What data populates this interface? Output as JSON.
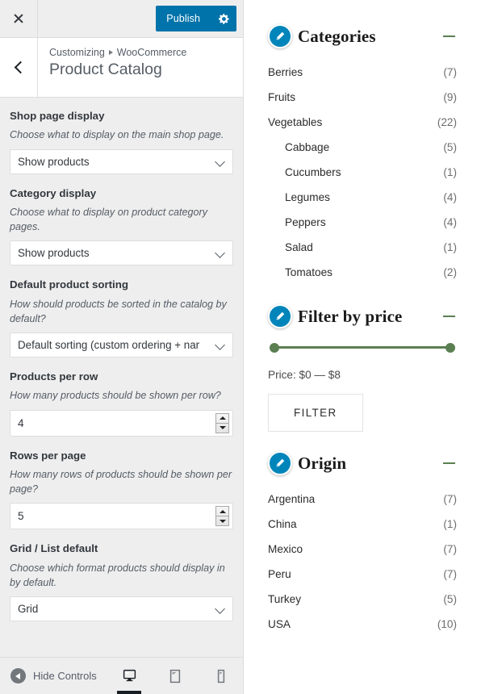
{
  "customizer": {
    "close_label": "Close",
    "publish_label": "Publish",
    "gear_icon": "gear-icon",
    "back_label": "Back",
    "breadcrumb": {
      "root": "Customizing",
      "section": "WooCommerce"
    },
    "title": "Product Catalog",
    "controls": [
      {
        "id": "shop-page-display",
        "label": "Shop page display",
        "description": "Choose what to display on the main shop page.",
        "type": "select",
        "value": "Show products"
      },
      {
        "id": "category-display",
        "label": "Category display",
        "description": "Choose what to display on product category pages.",
        "type": "select",
        "value": "Show products"
      },
      {
        "id": "default-product-sorting",
        "label": "Default product sorting",
        "description": "How should products be sorted in the catalog by default?",
        "type": "select",
        "value": "Default sorting (custom ordering + nar"
      },
      {
        "id": "products-per-row",
        "label": "Products per row",
        "description": "How many products should be shown per row?",
        "type": "number",
        "value": "4"
      },
      {
        "id": "rows-per-page",
        "label": "Rows per page",
        "description": "How many rows of products should be shown per page?",
        "type": "number",
        "value": "5"
      },
      {
        "id": "grid-list-default",
        "label": "Grid / List default",
        "description": "Choose which format products should display in by default.",
        "type": "select",
        "value": "Grid"
      }
    ],
    "footer": {
      "hide_controls_label": "Hide Controls",
      "hide_controls_icon": "collapse-left-icon",
      "devices": [
        {
          "id": "desktop",
          "icon": "desktop-icon",
          "active": true
        },
        {
          "id": "tablet",
          "icon": "tablet-icon",
          "active": false
        },
        {
          "id": "mobile",
          "icon": "mobile-icon",
          "active": false
        }
      ]
    }
  },
  "preview": {
    "edit_icon": "pencil-edit-icon",
    "collapse_icon": "minus-icon",
    "widgets": [
      {
        "id": "categories",
        "title": "Categories",
        "type": "term-list",
        "items": [
          {
            "name": "Berries",
            "count": "(7)",
            "child": false
          },
          {
            "name": "Fruits",
            "count": "(9)",
            "child": false
          },
          {
            "name": "Vegetables",
            "count": "(22)",
            "child": false
          },
          {
            "name": "Cabbage",
            "count": "(5)",
            "child": true
          },
          {
            "name": "Cucumbers",
            "count": "(1)",
            "child": true
          },
          {
            "name": "Legumes",
            "count": "(4)",
            "child": true
          },
          {
            "name": "Peppers",
            "count": "(4)",
            "child": true
          },
          {
            "name": "Salad",
            "count": "(1)",
            "child": true
          },
          {
            "name": "Tomatoes",
            "count": "(2)",
            "child": true
          }
        ]
      },
      {
        "id": "filter-by-price",
        "title": "Filter by price",
        "type": "price-filter",
        "price_label": "Price: $0 — $8",
        "min": "$0",
        "max": "$8",
        "button_label": "FILTER",
        "slider_color": "#5b7f52"
      },
      {
        "id": "origin",
        "title": "Origin",
        "type": "term-list",
        "items": [
          {
            "name": "Argentina",
            "count": "(7)",
            "child": false
          },
          {
            "name": "China",
            "count": "(1)",
            "child": false
          },
          {
            "name": "Mexico",
            "count": "(7)",
            "child": false
          },
          {
            "name": "Peru",
            "count": "(7)",
            "child": false
          },
          {
            "name": "Turkey",
            "count": "(5)",
            "child": false
          },
          {
            "name": "USA",
            "count": "(10)",
            "child": false
          }
        ]
      }
    ]
  },
  "colors": {
    "accent_blue": "#0073aa",
    "edit_shortcut_blue": "#0085ba",
    "slider_green": "#5b7f52",
    "sidebar_bg": "#eeeeee"
  }
}
